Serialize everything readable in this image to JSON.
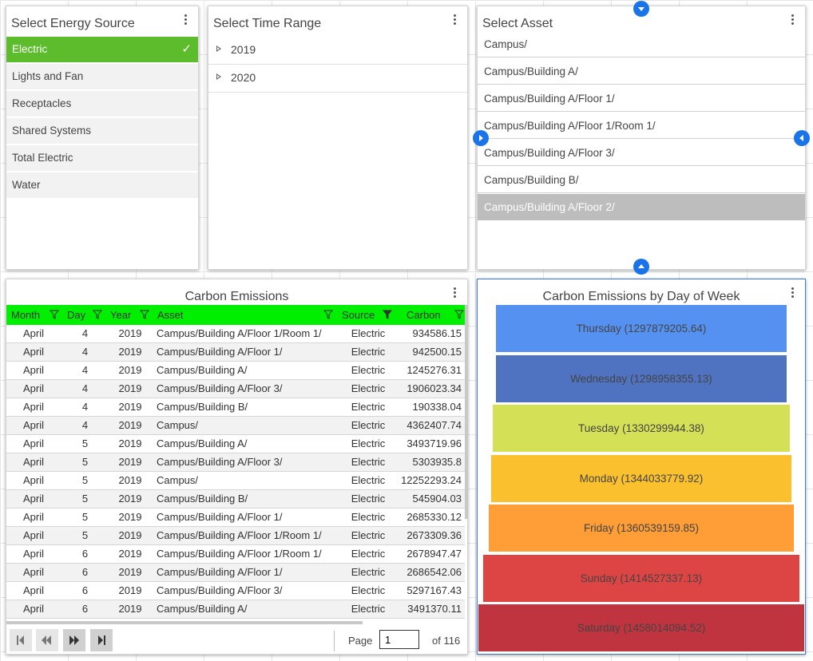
{
  "energy": {
    "title": "Select Energy Source",
    "items": [
      {
        "label": "Electric",
        "selected": true
      },
      {
        "label": "Lights and Fan",
        "selected": false
      },
      {
        "label": "Receptacles",
        "selected": false
      },
      {
        "label": "Shared Systems",
        "selected": false
      },
      {
        "label": "Total Electric",
        "selected": false
      },
      {
        "label": "Water",
        "selected": false
      }
    ],
    "check_glyph": "✓"
  },
  "time": {
    "title": "Select Time Range",
    "items": [
      {
        "label": "2019"
      },
      {
        "label": "2020"
      }
    ]
  },
  "asset": {
    "title": "Select Asset",
    "items": [
      {
        "label": "Campus/",
        "selected": false
      },
      {
        "label": "Campus/Building A/",
        "selected": false
      },
      {
        "label": "Campus/Building A/Floor 1/",
        "selected": false
      },
      {
        "label": "Campus/Building A/Floor 1/Room 1/",
        "selected": false
      },
      {
        "label": "Campus/Building A/Floor 3/",
        "selected": false
      },
      {
        "label": "Campus/Building B/",
        "selected": false
      },
      {
        "label": "Campus/Building A/Floor 2/",
        "selected": true
      }
    ]
  },
  "grid": {
    "title": "Carbon Emissions",
    "columns": [
      "Month",
      "Day",
      "Year",
      "Asset",
      "Source",
      "Carbon"
    ],
    "header_color": "#00ee00",
    "rows": [
      [
        "April",
        "4",
        "2019",
        "Campus/Building A/Floor 1/Room 1/",
        "Electric",
        "934586.15"
      ],
      [
        "April",
        "4",
        "2019",
        "Campus/Building A/Floor 1/",
        "Electric",
        "942500.15"
      ],
      [
        "April",
        "4",
        "2019",
        "Campus/Building A/",
        "Electric",
        "1245276.31"
      ],
      [
        "April",
        "4",
        "2019",
        "Campus/Building A/Floor 3/",
        "Electric",
        "1906023.34"
      ],
      [
        "April",
        "4",
        "2019",
        "Campus/Building B/",
        "Electric",
        "190338.04"
      ],
      [
        "April",
        "4",
        "2019",
        "Campus/",
        "Electric",
        "4362407.74"
      ],
      [
        "April",
        "5",
        "2019",
        "Campus/Building A/",
        "Electric",
        "3493719.96"
      ],
      [
        "April",
        "5",
        "2019",
        "Campus/Building A/Floor 3/",
        "Electric",
        "5303935.8"
      ],
      [
        "April",
        "5",
        "2019",
        "Campus/",
        "Electric",
        "12252293.24"
      ],
      [
        "April",
        "5",
        "2019",
        "Campus/Building B/",
        "Electric",
        "545904.03"
      ],
      [
        "April",
        "5",
        "2019",
        "Campus/Building A/Floor 1/",
        "Electric",
        "2685330.12"
      ],
      [
        "April",
        "5",
        "2019",
        "Campus/Building A/Floor 1/Room 1/",
        "Electric",
        "2673309.36"
      ],
      [
        "April",
        "6",
        "2019",
        "Campus/Building A/Floor 1/Room 1/",
        "Electric",
        "2678947.47"
      ],
      [
        "April",
        "6",
        "2019",
        "Campus/Building A/Floor 1/",
        "Electric",
        "2686542.06"
      ],
      [
        "April",
        "6",
        "2019",
        "Campus/Building A/Floor 3/",
        "Electric",
        "5297167.43"
      ],
      [
        "April",
        "6",
        "2019",
        "Campus/Building A/",
        "Electric",
        "3491370.11"
      ]
    ],
    "pager": {
      "page_label": "Page",
      "page_value": "1",
      "of_label": "of 116"
    }
  },
  "chart_data": {
    "type": "funnel",
    "title": "Carbon Emissions by Day of Week",
    "categories": [
      "Thursday",
      "Wednesday",
      "Tuesday",
      "Monday",
      "Friday",
      "Sunday",
      "Saturday"
    ],
    "values": [
      1297879205.64,
      1298958355.13,
      1330299944.38,
      1344033779.92,
      1360539159.85,
      1414527337.13,
      1458014094.52
    ],
    "labels": [
      "Thursday (1297879205.64)",
      "Wednesday (1298958355.13)",
      "Tuesday (1330299944.38)",
      "Monday (1344033779.92)",
      "Friday (1360539159.85)",
      "Sunday (1414527337.13)",
      "Saturday (1458014094.52)"
    ],
    "colors": [
      "#5591f0",
      "#4f73c0",
      "#d4e157",
      "#fbc02d",
      "#ff9d36",
      "#dd4444",
      "#c0343f"
    ]
  }
}
